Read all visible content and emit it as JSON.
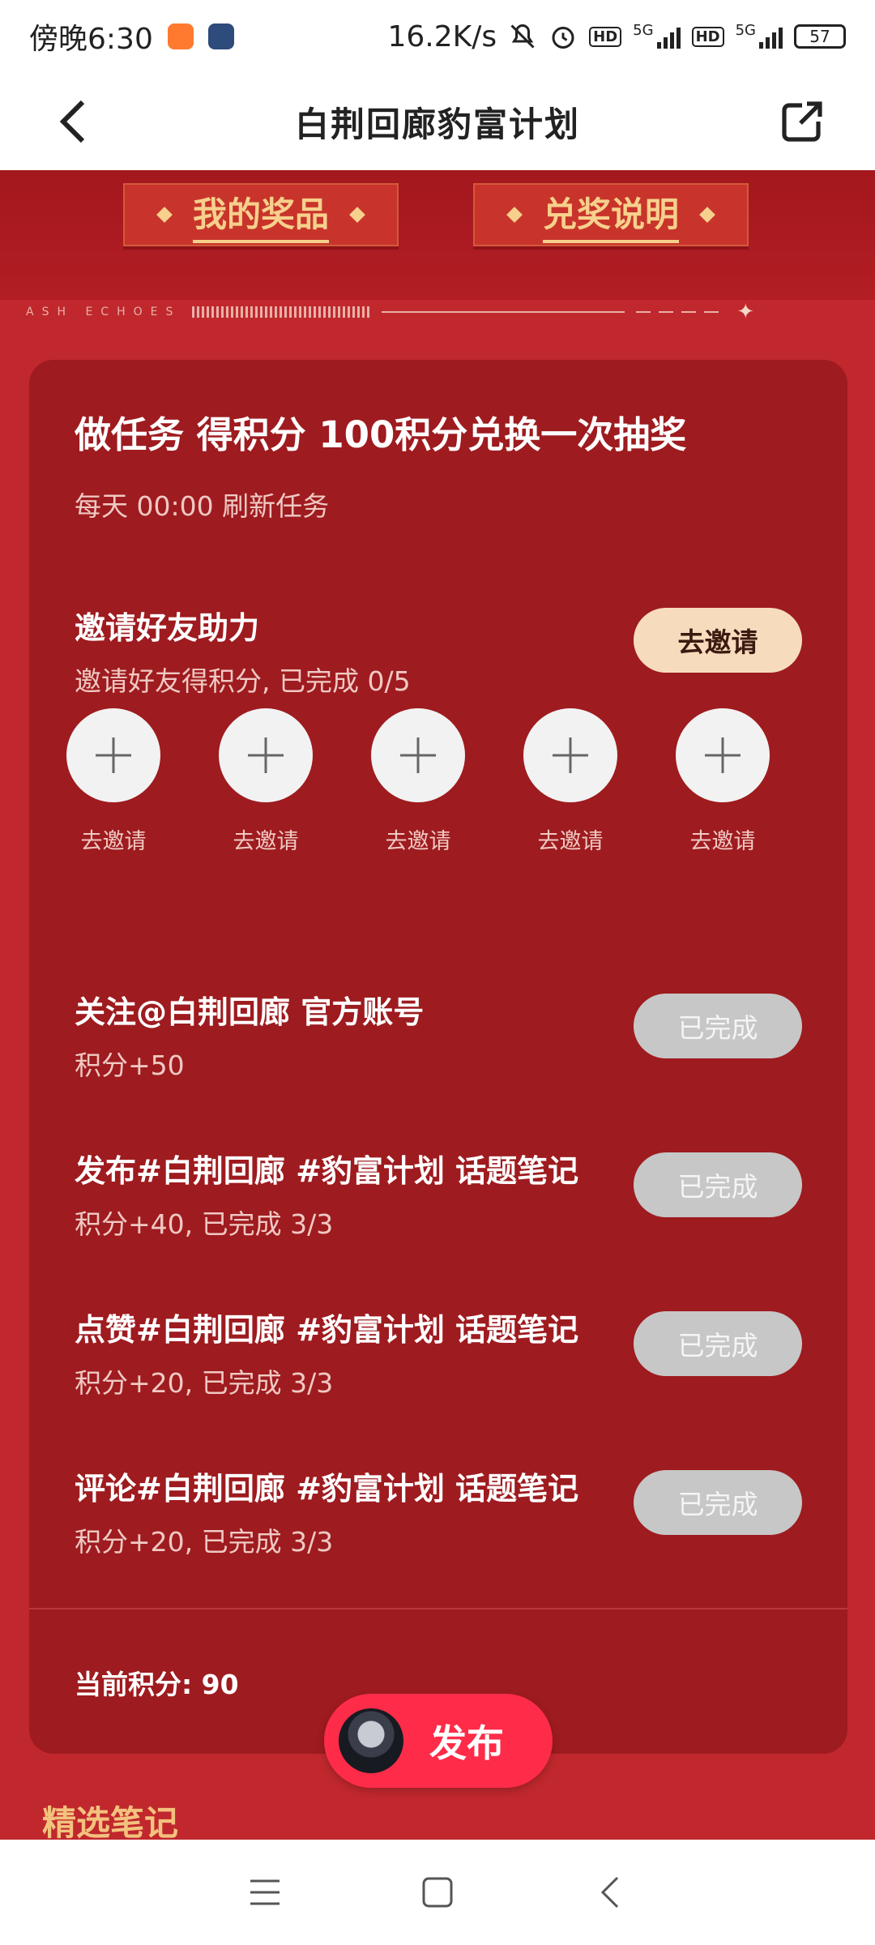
{
  "status_bar": {
    "time": "傍晚6:30",
    "speed": "16.2K/s",
    "network1": "5G",
    "network2": "5G",
    "hd": "HD",
    "battery": "57"
  },
  "nav": {
    "title": "白荆回廊豹富计划"
  },
  "banner": {
    "tab_prizes": "我的奖品",
    "tab_rules": "兑奖说明",
    "deco_text": "ASH ECHOES"
  },
  "card": {
    "title": "做任务 得积分 100积分兑换一次抽奖",
    "subtitle": "每天 00:00 刷新任务",
    "invite_task": {
      "title": "邀请好友助力",
      "desc": "邀请好友得积分, 已完成 0/5",
      "button": "去邀请",
      "slots": [
        "去邀请",
        "去邀请",
        "去邀请",
        "去邀请",
        "去邀请"
      ]
    },
    "tasks": [
      {
        "title": "关注@白荆回廊 官方账号",
        "desc": "积分+50",
        "button": "已完成"
      },
      {
        "title": "发布#白荆回廊 #豹富计划 话题笔记",
        "desc": "积分+40, 已完成 3/3",
        "button": "已完成"
      },
      {
        "title": "点赞#白荆回廊 #豹富计划 话题笔记",
        "desc": "积分+20, 已完成 3/3",
        "button": "已完成"
      },
      {
        "title": "评论#白荆回廊 #豹富计划 话题笔记",
        "desc": "积分+20, 已完成 3/3",
        "button": "已完成"
      }
    ],
    "points_label": "当前积分: 90"
  },
  "publish": {
    "label": "发布"
  },
  "section": {
    "title": "精选笔记"
  },
  "colors": {
    "page_red": "#c0282d",
    "card_red": "#9e1b1f",
    "gold": "#f6d08c",
    "invite_button": "#f6dcbd",
    "done_button": "#c7c7c7",
    "publish_red": "#fe2c48"
  }
}
